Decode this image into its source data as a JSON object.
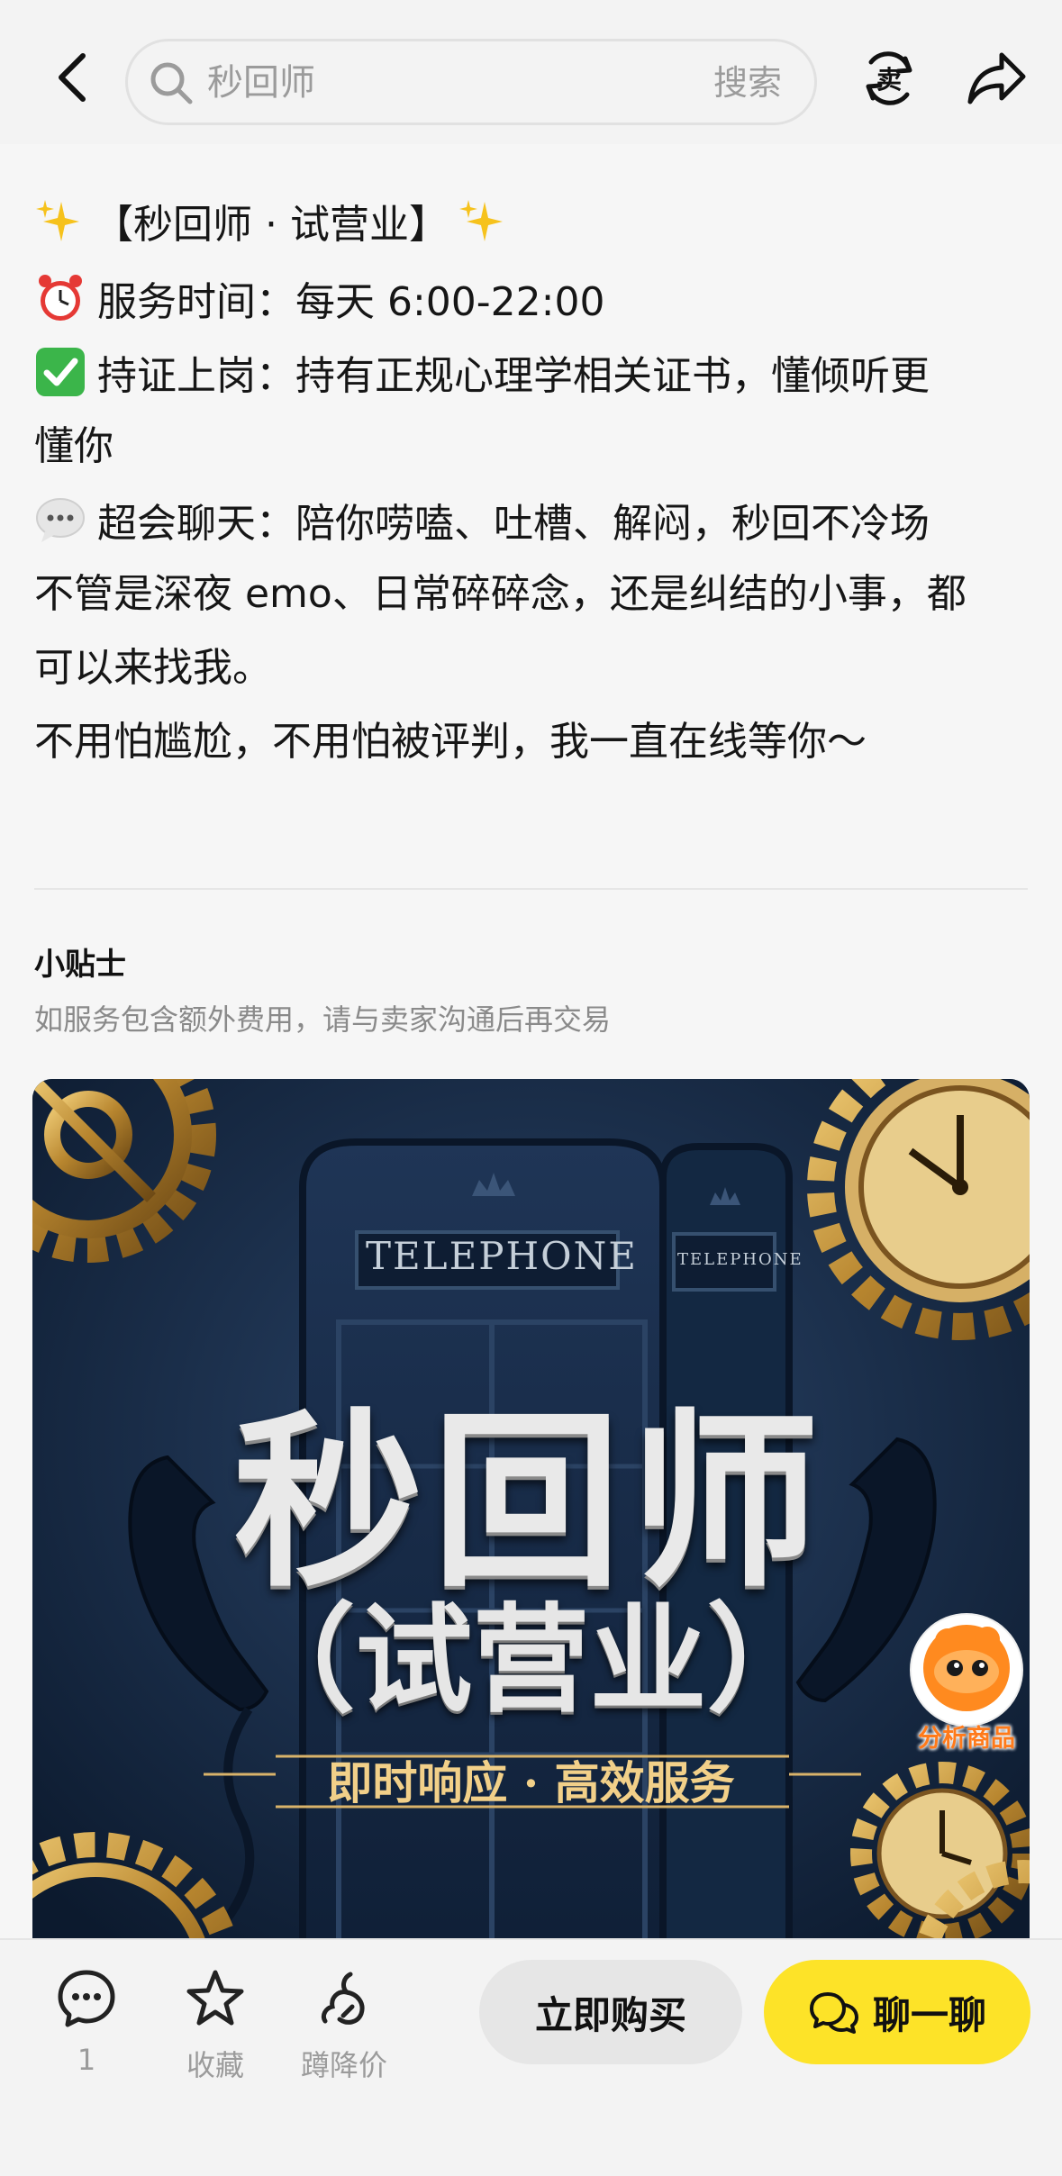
{
  "header": {
    "search_value": "秒回师",
    "search_button": "搜索",
    "icons": [
      "back-icon",
      "search-icon",
      "sell-icon",
      "share-icon"
    ]
  },
  "description": {
    "title_line": "【秒回师 · 试营业】",
    "lines": [
      "服务时间：每天 6:00-22:00",
      "持证上岗：持有正规心理学相关证书，懂倾听更",
      "懂你",
      "超会聊天：陪你唠嗑、吐槽、解闷，秒回不冷场",
      "不管是深夜 emo、日常碎碎念，还是纠结的小事，都",
      "可以来找我。",
      "不用怕尴尬，不用怕被评判，我一直在线等你～"
    ]
  },
  "tips": {
    "title": "小贴士",
    "text": "如服务包含额外费用，请与卖家沟通后再交易"
  },
  "poster": {
    "title": "秒回师",
    "subtitle": "（试营业）",
    "slogan": "即时响应 · 高效服务",
    "booth_label_front": "TELEPHONE",
    "booth_label_side": "TELEPHONE"
  },
  "floating": {
    "label": "分析商品"
  },
  "bottom_bar": {
    "comment_count": "1",
    "favorite_label": "收藏",
    "price_drop_label": "蹲降价",
    "buy_label": "立即购买",
    "chat_label": "聊一聊"
  },
  "colors": {
    "accent_yellow": "#fde328",
    "poster_bg": "#152741",
    "gold": "#c9a046"
  }
}
